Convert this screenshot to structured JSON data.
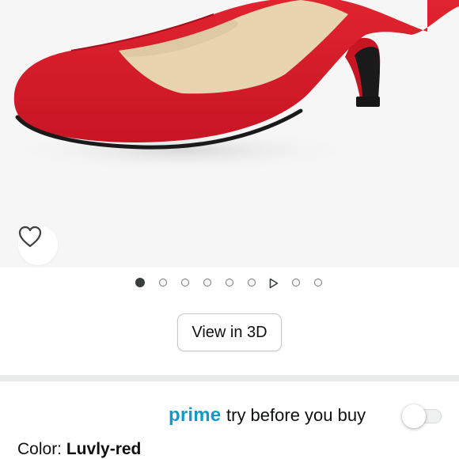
{
  "product_image": {
    "alt": "red pump shoe",
    "shoe_color": "#d41a2a",
    "wishlist_icon": "heart-outline-icon"
  },
  "carousel": {
    "indicators": [
      {
        "type": "image",
        "active": true
      },
      {
        "type": "image",
        "active": false
      },
      {
        "type": "image",
        "active": false
      },
      {
        "type": "image",
        "active": false
      },
      {
        "type": "image",
        "active": false
      },
      {
        "type": "image",
        "active": false
      },
      {
        "type": "video",
        "active": false
      },
      {
        "type": "image",
        "active": false
      },
      {
        "type": "image",
        "active": false
      }
    ]
  },
  "view3d": {
    "label": "View in 3D"
  },
  "prime": {
    "brand": "prime",
    "text": "try before you buy",
    "toggle_on": false,
    "brand_color": "#1399c6"
  },
  "color": {
    "label": "Color: ",
    "value": "Luvly-red"
  }
}
